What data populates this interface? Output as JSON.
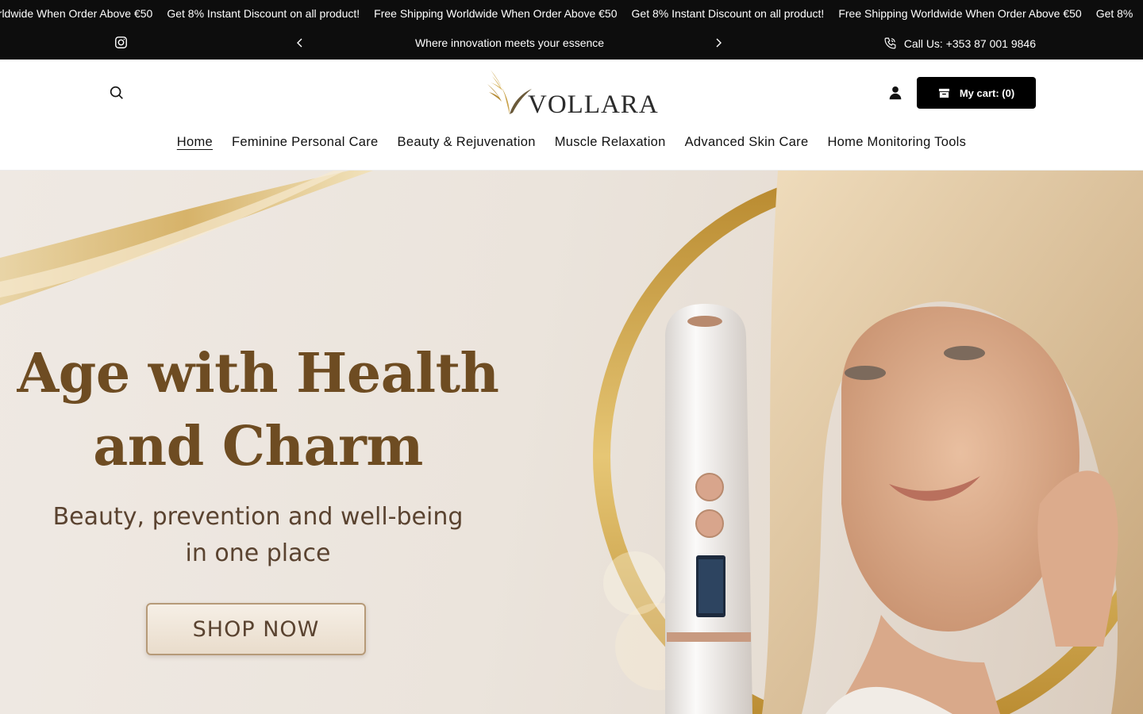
{
  "marquee": {
    "items": [
      "orldwide When Order Above €50",
      "Get 8% Instant Discount on all product!",
      "Free Shipping Worldwide When Order Above €50",
      "Get 8% Instant Discount on all product!",
      "Free Shipping Worldwide When Order Above €50",
      "Get 8%"
    ]
  },
  "announcement": {
    "text": "Where innovation meets your essence",
    "phone_label": "Call Us: +353 87 001 9846",
    "icons": {
      "social": "instagram-icon",
      "prev": "chevron-left-icon",
      "next": "chevron-right-icon",
      "phone": "phone-icon"
    }
  },
  "header": {
    "logo_text": "VOLLARA",
    "cart_label": "My cart: (0)",
    "icons": {
      "search": "search-icon",
      "account": "account-icon",
      "cart": "cart-icon"
    },
    "nav": [
      {
        "label": "Home",
        "active": true
      },
      {
        "label": "Feminine Personal Care",
        "active": false
      },
      {
        "label": "Beauty & Rejuvenation",
        "active": false
      },
      {
        "label": "Muscle Relaxation",
        "active": false
      },
      {
        "label": "Advanced Skin Care",
        "active": false
      },
      {
        "label": "Home Monitoring Tools",
        "active": false
      }
    ]
  },
  "hero": {
    "title_line1": "Age with Health",
    "title_line2": "and Charm",
    "subtitle_line1": "Beauty, prevention and well-being",
    "subtitle_line2": "in one place",
    "cta_label": "SHOP NOW"
  },
  "colors": {
    "topbar": "#0d0d0d",
    "hero_text": "#6e4c22",
    "gold": "#c9a24a",
    "cart_button": "#000000"
  }
}
